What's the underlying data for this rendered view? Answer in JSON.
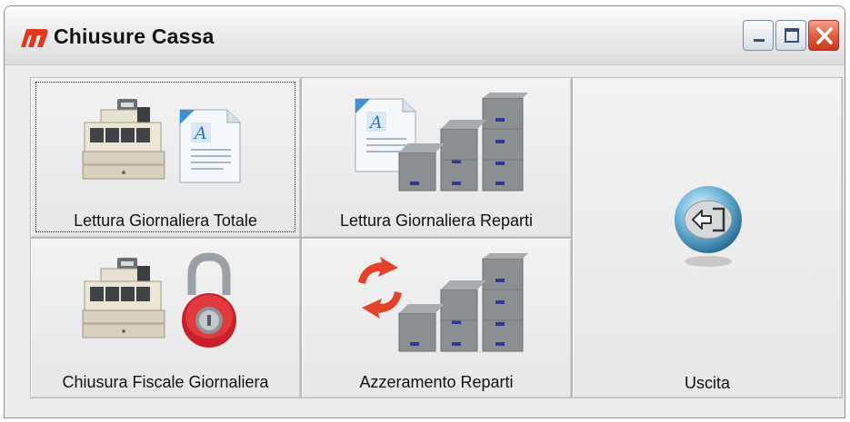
{
  "window": {
    "title": "Chiusure Cassa",
    "logo_icon": "app-m-logo",
    "controls": [
      "minimize-icon",
      "maximize-icon",
      "close-icon"
    ]
  },
  "buttons": [
    {
      "id": "lettura_totale",
      "label": "Lettura Giornaliera Totale",
      "icons": [
        "cash-register-icon",
        "document-icon"
      ],
      "focused": true
    },
    {
      "id": "lettura_reparti",
      "label": "Lettura Giornaliera Reparti",
      "icons": [
        "document-icon",
        "boxes-chart-icon"
      ]
    },
    {
      "id": "uscita",
      "label": "Uscita",
      "icons": [
        "exit-icon"
      ]
    },
    {
      "id": "chiusura_fiscale",
      "label": "Chiusura Fiscale Giornaliera",
      "icons": [
        "cash-register-icon",
        "padlock-icon"
      ]
    },
    {
      "id": "azzeramento_reparti",
      "label": "Azzeramento Reparti",
      "icons": [
        "refresh-arrows-icon",
        "boxes-chart-icon"
      ]
    }
  ],
  "colors": {
    "close_red": "#de5a3b",
    "logo_red": "#e03a1e",
    "exit_blue": "#6fb6d8"
  }
}
